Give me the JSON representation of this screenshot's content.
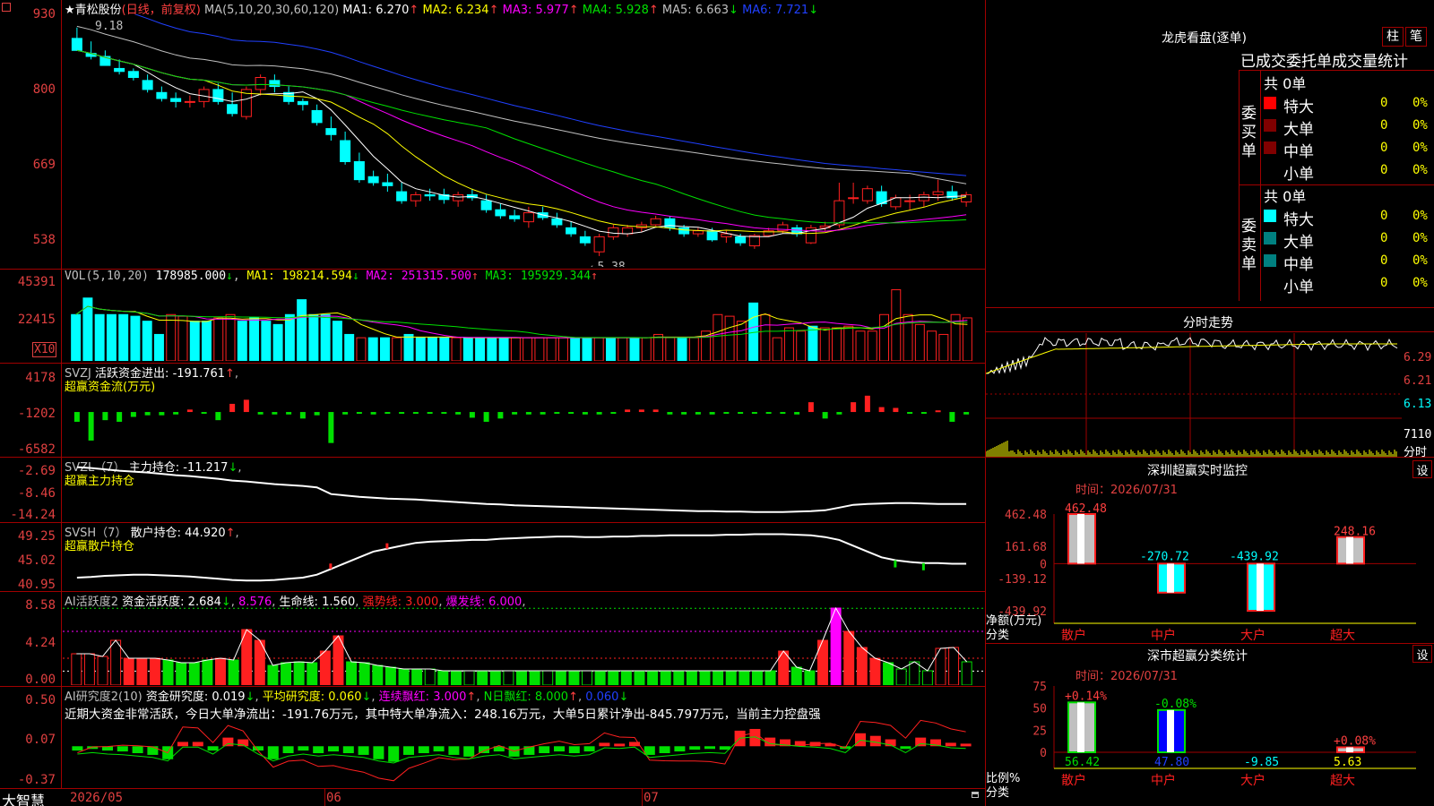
{
  "app": {
    "logo": "大智慧",
    "corner_icon": "square-icon"
  },
  "stock": {
    "star": "★",
    "name": "青松股份",
    "period": "(日线，前复权)"
  },
  "kline": {
    "ma_title": "MA(5,10,20,30,60,120)",
    "ma": [
      {
        "label": "MA1:",
        "value": "6.270",
        "arrow": "↑",
        "color": "#ffffff"
      },
      {
        "label": "MA2:",
        "value": "6.234",
        "arrow": "↑",
        "color": "#ffff00"
      },
      {
        "label": "MA3:",
        "value": "5.977",
        "arrow": "↑",
        "color": "#ff00ff"
      },
      {
        "label": "MA4:",
        "value": "5.928",
        "arrow": "↑",
        "color": "#00e000"
      },
      {
        "label": "MA5:",
        "value": "6.663",
        "arrow": "↓",
        "color": "#c0c0c0"
      },
      {
        "label": "MA6:",
        "value": "7.721",
        "arrow": "↓",
        "color": "#2040ff"
      }
    ],
    "yaxis": [
      "930",
      "800",
      "669",
      "538"
    ],
    "high_note": "9.18",
    "low_note": "←5.38",
    "candles": [
      [
        9.0,
        9.18,
        8.9,
        8.8
      ],
      [
        8.75,
        8.95,
        8.65,
        8.7
      ],
      [
        8.7,
        8.8,
        8.55,
        8.55
      ],
      [
        8.5,
        8.65,
        8.4,
        8.45
      ],
      [
        8.45,
        8.5,
        8.3,
        8.35
      ],
      [
        8.3,
        8.4,
        8.1,
        8.15
      ],
      [
        8.1,
        8.2,
        7.95,
        8.0
      ],
      [
        8.0,
        8.1,
        7.85,
        7.95
      ],
      [
        7.95,
        8.05,
        7.85,
        7.95
      ],
      [
        7.95,
        8.2,
        7.85,
        8.15
      ],
      [
        8.15,
        8.25,
        7.9,
        7.95
      ],
      [
        7.9,
        8.1,
        7.7,
        7.75
      ],
      [
        7.7,
        8.2,
        7.65,
        8.15
      ],
      [
        8.15,
        8.4,
        8.05,
        8.35
      ],
      [
        8.3,
        8.4,
        8.1,
        8.2
      ],
      [
        8.1,
        8.2,
        7.9,
        7.95
      ],
      [
        7.95,
        8.0,
        7.8,
        7.9
      ],
      [
        7.8,
        7.9,
        7.55,
        7.6
      ],
      [
        7.5,
        7.7,
        7.3,
        7.4
      ],
      [
        7.3,
        7.45,
        6.9,
        6.95
      ],
      [
        6.95,
        7.1,
        6.6,
        6.65
      ],
      [
        6.7,
        6.8,
        6.55,
        6.6
      ],
      [
        6.6,
        6.75,
        6.45,
        6.55
      ],
      [
        6.45,
        6.6,
        6.25,
        6.3
      ],
      [
        6.3,
        6.45,
        6.2,
        6.4
      ],
      [
        6.4,
        6.5,
        6.3,
        6.38
      ],
      [
        6.4,
        6.5,
        6.25,
        6.32
      ],
      [
        6.3,
        6.45,
        6.2,
        6.4
      ],
      [
        6.4,
        6.5,
        6.3,
        6.35
      ],
      [
        6.3,
        6.4,
        6.1,
        6.15
      ],
      [
        6.15,
        6.25,
        6.0,
        6.05
      ],
      [
        6.05,
        6.15,
        5.95,
        6.0
      ],
      [
        5.95,
        6.2,
        5.85,
        6.1
      ],
      [
        6.1,
        6.2,
        5.98,
        6.02
      ],
      [
        6.0,
        6.1,
        5.85,
        5.9
      ],
      [
        5.85,
        5.95,
        5.7,
        5.75
      ],
      [
        5.7,
        5.8,
        5.55,
        5.6
      ],
      [
        5.45,
        5.75,
        5.38,
        5.7
      ],
      [
        5.7,
        5.9,
        5.65,
        5.85
      ],
      [
        5.75,
        5.9,
        5.7,
        5.85
      ],
      [
        5.85,
        5.95,
        5.78,
        5.9
      ],
      [
        5.9,
        6.05,
        5.88,
        6.0
      ],
      [
        6.0,
        6.05,
        5.8,
        5.85
      ],
      [
        5.85,
        5.9,
        5.7,
        5.75
      ],
      [
        5.75,
        5.85,
        5.7,
        5.8
      ],
      [
        5.8,
        5.85,
        5.62,
        5.65
      ],
      [
        5.7,
        5.8,
        5.6,
        5.75
      ],
      [
        5.7,
        5.75,
        5.55,
        5.6
      ],
      [
        5.55,
        5.75,
        5.5,
        5.72
      ],
      [
        5.72,
        5.85,
        5.7,
        5.8
      ],
      [
        5.8,
        5.95,
        5.75,
        5.9
      ],
      [
        5.85,
        5.9,
        5.7,
        5.75
      ],
      [
        5.6,
        5.9,
        5.58,
        5.85
      ],
      [
        5.85,
        5.95,
        5.8,
        5.88
      ],
      [
        5.9,
        6.6,
        5.85,
        6.3
      ],
      [
        6.35,
        6.6,
        6.25,
        6.35
      ],
      [
        6.3,
        6.55,
        6.25,
        6.5
      ],
      [
        6.45,
        6.55,
        6.2,
        6.25
      ],
      [
        6.2,
        6.4,
        6.15,
        6.35
      ],
      [
        6.3,
        6.4,
        6.15,
        6.3
      ],
      [
        6.3,
        6.45,
        6.2,
        6.4
      ],
      [
        6.4,
        6.65,
        6.3,
        6.45
      ],
      [
        6.45,
        6.55,
        6.3,
        6.35
      ],
      [
        6.28,
        6.45,
        6.2,
        6.4
      ]
    ]
  },
  "vol": {
    "title": "VOL(5,10,20)",
    "main": "178985.000",
    "main_arrow": "↓",
    "ma": [
      {
        "label": "MA1:",
        "value": "198214.594",
        "arrow": "↓",
        "color": "#ffff00"
      },
      {
        "label": "MA2:",
        "value": "251315.500",
        "arrow": "↑",
        "color": "#ff00ff"
      },
      {
        "label": "MA3:",
        "value": "195929.344",
        "arrow": "↑",
        "color": "#00e000"
      }
    ],
    "yaxis": [
      "45391",
      "22415"
    ],
    "unit": "X10",
    "values": [
      28,
      38,
      28,
      28,
      28,
      27,
      24,
      16,
      28,
      27,
      24,
      24,
      26,
      28,
      24,
      26,
      24,
      22,
      28,
      37,
      28,
      28,
      24,
      16,
      14,
      14,
      14,
      14,
      16,
      14,
      14,
      14,
      14,
      14,
      14,
      14,
      14,
      14,
      14,
      14,
      14,
      14,
      14,
      14,
      14,
      14,
      14,
      14,
      14,
      16,
      14,
      14,
      14,
      18,
      28,
      27,
      24,
      35,
      28,
      14,
      20,
      18,
      21,
      20,
      20,
      21,
      18,
      18,
      28,
      43,
      28,
      22,
      18,
      16,
      28,
      26
    ]
  },
  "svzj": {
    "title": "SVZJ",
    "label": "活跃资金进出:",
    "value": "-191.761",
    "arrow": "↑",
    "sub": "超赢资金流(万元)",
    "yaxis": [
      "4178",
      "-1202",
      "-6582"
    ],
    "values": [
      -1200,
      -3500,
      -1000,
      -1200,
      -600,
      -400,
      -400,
      -300,
      300,
      -200,
      -1000,
      1000,
      1500,
      -300,
      -300,
      -300,
      -800,
      -400,
      -3800,
      -300,
      -200,
      -300,
      -200,
      -100,
      -200,
      -200,
      -200,
      -300,
      -700,
      -1200,
      -800,
      -300,
      -300,
      -300,
      -200,
      -200,
      -300,
      -300,
      -200,
      300,
      300,
      300,
      -300,
      -300,
      -300,
      -300,
      -200,
      -200,
      -200,
      -200,
      -200,
      -300,
      1200,
      -800,
      -300,
      1200,
      2000,
      600,
      500,
      -200,
      -200,
      200,
      -1200,
      -300
    ]
  },
  "svzl": {
    "title": "SVZL（7）",
    "label": "主力持仓:",
    "value": "-11.217",
    "arrow": "↓",
    "sub": "超赢主力持仓",
    "yaxis": [
      "-2.69",
      "-8.46",
      "-14.24"
    ],
    "values": [
      -3,
      -3.2,
      -3.5,
      -3.8,
      -4,
      -4.2,
      -4.5,
      -4.8,
      -5,
      -5.3,
      -5.6,
      -6,
      -6.2,
      -6.5,
      -6.8,
      -7,
      -7.2,
      -7.5,
      -9,
      -9.3,
      -9.6,
      -9.8,
      -10,
      -10.1,
      -10.2,
      -10.4,
      -10.6,
      -10.8,
      -11,
      -11.2,
      -11.3,
      -11.5,
      -11.6,
      -11.7,
      -11.8,
      -11.9,
      -12,
      -12.1,
      -12.2,
      -12.3,
      -12.4,
      -12.5,
      -12.6,
      -12.7,
      -12.8,
      -12.8,
      -12.9,
      -12.9,
      -13,
      -13,
      -13,
      -12.9,
      -12.8,
      -12.6,
      -12,
      -11.4,
      -11.2,
      -11.1,
      -11,
      -11,
      -11.1,
      -11.2,
      -11.2,
      -11.2
    ]
  },
  "svsh": {
    "title": "SVSH（7）",
    "label": "散户持仓:",
    "value": "44.920",
    "arrow": "↑",
    "sub": "超赢散户持仓",
    "yaxis": [
      "49.25",
      "45.02",
      "40.95"
    ],
    "values": [
      42.5,
      42.6,
      42.8,
      42.9,
      43,
      43,
      42.9,
      42.8,
      42.7,
      42.5,
      42.3,
      42.1,
      42,
      42,
      42.1,
      42.3,
      42.5,
      43,
      44,
      45,
      46,
      47,
      47.5,
      48,
      48.5,
      48.7,
      48.8,
      48.9,
      49,
      49,
      49.2,
      49.3,
      49.4,
      49.5,
      49.6,
      49.6,
      49.5,
      49.5,
      49.6,
      49.6,
      49.7,
      49.7,
      49.8,
      49.8,
      49.8,
      49.8,
      49.9,
      49.9,
      50,
      50,
      50,
      49.9,
      49.8,
      49.5,
      49,
      48,
      47,
      46,
      45.5,
      45.2,
      45,
      45,
      44.9,
      44.9
    ]
  },
  "ai_active": {
    "title": "AI活跃度2",
    "label": "资金活跃度:",
    "value": "2.684",
    "arrow": "↓",
    "v2": "8.576",
    "life_label": "生命线:",
    "life": "1.560",
    "strong_label": "强势线:",
    "strong": "3.000",
    "burst_label": "爆发线:",
    "burst": "6.000",
    "yaxis": [
      "8.58",
      "4.24",
      "0.00"
    ],
    "values": [
      3.5,
      3.5,
      3.2,
      5,
      3,
      3,
      3,
      2.8,
      2.5,
      2.5,
      2.8,
      3,
      2.8,
      6.2,
      5,
      2.2,
      2.5,
      2.6,
      2.5,
      3.8,
      5.5,
      2.6,
      2.5,
      2.2,
      2,
      1.8,
      1.8,
      1.8,
      1.6,
      1.6,
      1.6,
      1.6,
      1.6,
      1.6,
      1.6,
      1.6,
      1.6,
      1.6,
      1.6,
      1.6,
      1.6,
      1.6,
      1.6,
      1.6,
      1.6,
      1.6,
      1.6,
      1.6,
      1.6,
      1.6,
      1.6,
      1.6,
      1.6,
      1.6,
      3.8,
      2,
      1.6,
      5,
      8.6,
      6,
      4.2,
      3,
      2.5,
      1.8,
      2.6,
      1.6,
      4.1,
      4.2,
      2.6
    ]
  },
  "ai_research": {
    "title": "AI研究度2(10)",
    "label": "资金研究度:",
    "value": "0.019",
    "arrow": "↓",
    "avg_label": "平均研究度:",
    "avg": "0.060",
    "avg_arrow": "↓",
    "red_label": "连续飘红:",
    "red": "3.000",
    "red_arrow": "↑",
    "nred_label": "N日飘红:",
    "nred": "8.000",
    "nred_arrow": "↑",
    "last": "0.060",
    "last_arrow": "↓",
    "note": "近期大资金非常活跃，今日大单净流出：-191.76万元，其中特大单净流入：248.16万元，大单5日累计净出-845.797万元，当前主力控盘强",
    "yaxis": [
      "0.50",
      "0.07",
      "-0.37"
    ],
    "values": [
      -0.05,
      -0.03,
      -0.05,
      -0.06,
      -0.08,
      -0.1,
      -0.15,
      0.05,
      0.05,
      -0.05,
      0.1,
      0.08,
      -0.05,
      -0.15,
      -0.08,
      -0.05,
      -0.08,
      -0.06,
      -0.08,
      -0.1,
      -0.15,
      -0.18,
      -0.1,
      -0.08,
      -0.06,
      -0.1,
      -0.12,
      -0.08,
      -0.06,
      -0.12,
      -0.1,
      -0.08,
      -0.06,
      -0.08,
      -0.06,
      0.04,
      0.03,
      0.05,
      -0.1,
      -0.08,
      -0.06,
      -0.04,
      -0.03,
      -0.04,
      0.18,
      0.2,
      0.1,
      0.08,
      0.06,
      0.05,
      0.03,
      -0.03,
      0.15,
      0.12,
      0.08,
      -0.03,
      0.1,
      0.08,
      0.04,
      0.03
    ]
  },
  "xaxis": [
    "2026/05",
    "06",
    "07"
  ],
  "right": {
    "lhb": {
      "title": "龙虎看盘(逐单)",
      "btn1": "柱",
      "btn2": "笔",
      "subtitle": "已成交委托单成交量统计",
      "buy": {
        "total": "共 0单",
        "side": [
          "委",
          "买",
          "单"
        ],
        "rows": [
          {
            "color": "#ff0000",
            "label": "特大",
            "n": "0",
            "p": "0%"
          },
          {
            "color": "#800000",
            "label": "大单",
            "n": "0",
            "p": "0%"
          },
          {
            "color": "#800000",
            "label": "中单",
            "n": "0",
            "p": "0%"
          },
          {
            "color": "",
            "label": "小单",
            "n": "0",
            "p": "0%"
          }
        ]
      },
      "sell": {
        "total": "共 0单",
        "side": [
          "委",
          "卖",
          "单"
        ],
        "rows": [
          {
            "color": "#00ffff",
            "label": "特大",
            "n": "0",
            "p": "0%"
          },
          {
            "color": "#008080",
            "label": "大单",
            "n": "0",
            "p": "0%"
          },
          {
            "color": "#008080",
            "label": "中单",
            "n": "0",
            "p": "0%"
          },
          {
            "color": "",
            "label": "小单",
            "n": "0",
            "p": "0%"
          }
        ]
      }
    },
    "fenshi": {
      "title": "分时走势",
      "yaxis": [
        "6.29",
        "6.21",
        "6.13"
      ],
      "vol_label": "7110",
      "vol_unit": "分时"
    },
    "sz_monitor": {
      "title": "深圳超赢实时监控",
      "set_btn": "设",
      "time_label": "时间：2026/07/31",
      "yaxis": [
        "462.48",
        "161.68",
        "0",
        "-139.12",
        "-439.92"
      ],
      "ylabel1": "净额(万元)",
      "ylabel2": "分类",
      "bars": [
        {
          "cat": "散户",
          "value": 462.48,
          "label": "462.48"
        },
        {
          "cat": "中户",
          "value": -270.72,
          "label": "-270.72"
        },
        {
          "cat": "大户",
          "value": -439.92,
          "label": "-439.92"
        },
        {
          "cat": "超大",
          "value": 248.16,
          "label": "248.16"
        }
      ]
    },
    "sz_class": {
      "title": "深市超赢分类统计",
      "set_btn": "设",
      "time_label": "时间：2026/07/31",
      "yaxis": [
        "75",
        "50",
        "25",
        "0"
      ],
      "ylabel1": "比例%",
      "ylabel2": "分类",
      "bars": [
        {
          "cat": "散户",
          "value": 56.42,
          "label": "56.42",
          "delta": "+0.14%"
        },
        {
          "cat": "中户",
          "value": 47.8,
          "label": "47.80",
          "delta": "-0.08%"
        },
        {
          "cat": "大户",
          "value": -9.85,
          "label": "-9.85",
          "delta": ""
        },
        {
          "cat": "超大",
          "value": 5.63,
          "label": "5.63",
          "delta": "+0.08%"
        }
      ]
    }
  },
  "colors": {
    "up": "#ff2020",
    "down": "#00ffff",
    "grid": "#a00000",
    "axis": "#e04040"
  }
}
